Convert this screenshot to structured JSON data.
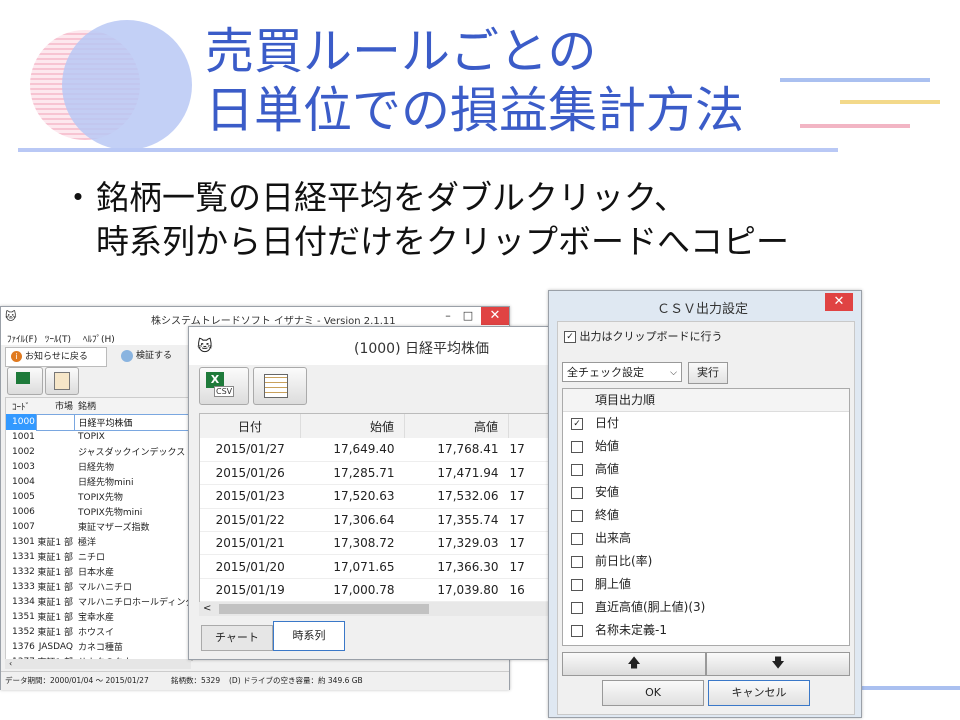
{
  "slide": {
    "title_lines": [
      "売買ルールごとの",
      "日単位での損益集計方法"
    ],
    "bullet_mark": "・",
    "bullet_lines": [
      "銘柄一覧の日経平均をダブルクリック、",
      "時系列から日付だけをクリップボードへコピー"
    ]
  },
  "main_window": {
    "title": "株システムトレードソフト イザナミ - Version 2.1.11",
    "menu": [
      "ﾌｧｲﾙ(F)",
      "ﾂｰﾙ(T)",
      "ﾍﾙﾌﾟ(H)"
    ],
    "notice_button": "お知らせに戻る",
    "verify_button": "検証する",
    "columns": [
      "ｺｰﾄﾞ",
      "市場",
      "銘柄"
    ],
    "rows": [
      {
        "code": "1000",
        "market": "",
        "name": "日経平均株価"
      },
      {
        "code": "1001",
        "market": "",
        "name": "TOPIX"
      },
      {
        "code": "1002",
        "market": "",
        "name": "ジャスダックインデックス"
      },
      {
        "code": "1003",
        "market": "",
        "name": "日経先物"
      },
      {
        "code": "1004",
        "market": "",
        "name": "日経先物mini"
      },
      {
        "code": "1005",
        "market": "",
        "name": "TOPIX先物"
      },
      {
        "code": "1006",
        "market": "",
        "name": "TOPIX先物mini"
      },
      {
        "code": "1007",
        "market": "",
        "name": "東証マザーズ指数"
      },
      {
        "code": "1301",
        "market": "東証1 部",
        "name": "極洋"
      },
      {
        "code": "1331",
        "market": "東証1 部",
        "name": "ニチロ"
      },
      {
        "code": "1332",
        "market": "東証1 部",
        "name": "日本水産"
      },
      {
        "code": "1333",
        "market": "東証1 部",
        "name": "マルハニチロ"
      },
      {
        "code": "1334",
        "market": "東証1 部",
        "name": "マルハニチロホールディングス"
      },
      {
        "code": "1351",
        "market": "東証1 部",
        "name": "宝幸水産"
      },
      {
        "code": "1352",
        "market": "東証1 部",
        "name": "ホウスイ"
      },
      {
        "code": "1376",
        "market": "JASDAQ",
        "name": "カネコ種苗"
      },
      {
        "code": "1377",
        "market": "東証1 部",
        "name": "サカタのタネ"
      }
    ],
    "status": {
      "period": "データ期間：2000/01/04 ～ 2015/01/27",
      "count": "銘柄数：5329",
      "disk": "(D) ドライブの空き容量：約 349.6 GB"
    }
  },
  "chart_window": {
    "title": "(1000) 日経平均株価",
    "columns": [
      "日付",
      "始値",
      "高値",
      ""
    ],
    "rows": [
      {
        "date": "2015/01/27",
        "open": "17,649.40",
        "high": "17,768.41",
        "low": "17"
      },
      {
        "date": "2015/01/26",
        "open": "17,285.71",
        "high": "17,471.94",
        "low": "17"
      },
      {
        "date": "2015/01/23",
        "open": "17,520.63",
        "high": "17,532.06",
        "low": "17"
      },
      {
        "date": "2015/01/22",
        "open": "17,306.64",
        "high": "17,355.74",
        "low": "17"
      },
      {
        "date": "2015/01/21",
        "open": "17,308.72",
        "high": "17,329.03",
        "low": "17"
      },
      {
        "date": "2015/01/20",
        "open": "17,071.65",
        "high": "17,366.30",
        "low": "17"
      },
      {
        "date": "2015/01/19",
        "open": "17,000.78",
        "high": "17,039.80",
        "low": "16"
      }
    ],
    "tabs": [
      "チャート",
      "時系列"
    ],
    "scroll_left": "<"
  },
  "csv_dialog": {
    "title": "ＣＳＶ出力設定",
    "close_glyph": "✕",
    "clipboard_label": "出力はクリップボードに行う",
    "select_value": "全チェック設定",
    "run_button": "実行",
    "list_header": "項目出力順",
    "items": [
      {
        "label": "日付",
        "checked": true
      },
      {
        "label": "始値",
        "checked": false
      },
      {
        "label": "高値",
        "checked": false
      },
      {
        "label": "安値",
        "checked": false
      },
      {
        "label": "終値",
        "checked": false
      },
      {
        "label": "出来高",
        "checked": false
      },
      {
        "label": "前日比(率)",
        "checked": false
      },
      {
        "label": "胴上値",
        "checked": false
      },
      {
        "label": "直近高値(胴上値)(3)",
        "checked": false
      },
      {
        "label": "名称未定義-1",
        "checked": false
      }
    ],
    "up_glyph": "🡅",
    "down_glyph": "🡇",
    "ok_button": "OK",
    "cancel_button": "キャンセル"
  },
  "window_controls": {
    "minimize": "–",
    "maximize": "□",
    "close": "✕"
  },
  "colors": {
    "title_blue": "#3b5cc8",
    "circle_blue": "#b9c8f5",
    "circle_pink": "#f7c4d2",
    "accent_red": "#e04343",
    "selection_blue": "#3399ff"
  }
}
